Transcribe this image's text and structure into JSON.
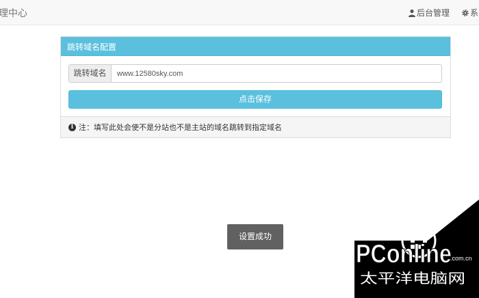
{
  "navbar": {
    "brand": "理中心",
    "admin_label": "后台管理",
    "admin_icon": "user-icon",
    "system_label": "系",
    "system_icon": "gear-icon"
  },
  "panel": {
    "heading": "跳转域名配置",
    "field_label": "跳转域名",
    "field_value": "www.12580sky.com",
    "save_label": "点击保存",
    "note_icon": "info-icon",
    "note": "注：填写此处会使不是分站也不是主站的域名跳转到指定域名"
  },
  "toast": {
    "message": "设置成功"
  },
  "watermark": {
    "logo_text": "PConline",
    "domain_text": ".com.cn",
    "chinese_text": "太平洋电脑网",
    "accent_color": "#000000"
  }
}
